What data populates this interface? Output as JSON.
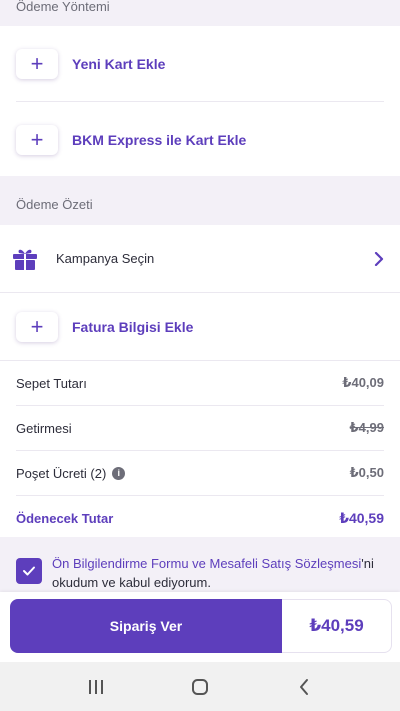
{
  "payment_method": {
    "header": "Ödeme Yöntemi",
    "add_card_label": "Yeni Kart Ekle",
    "bkm_label": "BKM Express ile Kart Ekle"
  },
  "summary": {
    "header": "Ödeme Özeti",
    "campaign_label": "Kampanya Seçin",
    "invoice_label": "Fatura Bilgisi Ekle",
    "rows": {
      "basket": {
        "label": "Sepet Tutarı",
        "value": "₺40,09"
      },
      "delivery": {
        "label": "Getirmesi",
        "value": "₺4,99"
      },
      "bag": {
        "label": "Poşet Ücreti (2)",
        "value": "₺0,50"
      },
      "total": {
        "label": "Ödenecek Tutar",
        "value": "₺40,59"
      }
    }
  },
  "agreement": {
    "link_text": "Ön Bilgilendirme Formu ve Mesafeli Satış Sözleşmesi",
    "rest_text": "'ni okudum ve kabul ediyorum.",
    "checked": true
  },
  "bottom_bar": {
    "button_label": "Sipariş Ver",
    "total": "₺40,59"
  },
  "icons": {
    "plus": "plus-icon",
    "gift": "gift-icon",
    "chevron": "chevron-right-icon",
    "info": "info-icon",
    "check": "check-icon",
    "recents": "recents-icon",
    "home": "home-icon",
    "back": "back-icon"
  },
  "colors": {
    "brand": "#5d3ebc",
    "background": "#f3f0f7",
    "muted": "#6d6d78"
  }
}
